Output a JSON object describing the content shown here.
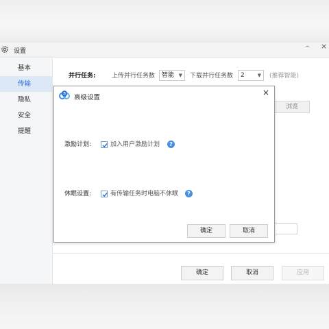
{
  "window": {
    "title": "设置",
    "minimize_icon": "minimize-icon",
    "close_icon": "close-icon"
  },
  "sidebar": {
    "items": [
      {
        "label": "基本",
        "active": false
      },
      {
        "label": "传输",
        "active": true
      },
      {
        "label": "隐私",
        "active": false
      },
      {
        "label": "安全",
        "active": false
      },
      {
        "label": "提醒",
        "active": false
      }
    ]
  },
  "transfer": {
    "parallel_label": "并行任务:",
    "upload_label": "上传并行任务数",
    "upload_value": "智能",
    "download_label": "下载并行任务数",
    "download_value": "2",
    "hint": "(推荐智能)",
    "browse_label": "浏览"
  },
  "footer": {
    "ok_label": "确定",
    "cancel_label": "取消",
    "apply_label": "应用"
  },
  "dialog": {
    "title": "高级设置",
    "incentive": {
      "label": "激励计划:",
      "checkbox_text": "加入用户激励计划",
      "checked": true
    },
    "sleep": {
      "label": "休眠设置:",
      "checkbox_text": "有传输任务时电脑不休眠",
      "checked": true
    },
    "ok_label": "确定",
    "cancel_label": "取消",
    "help_glyph": "?"
  },
  "colors": {
    "accent": "#2d6cd6",
    "active_bg": "#dde8f6",
    "help_blue": "#4a8ee6"
  }
}
